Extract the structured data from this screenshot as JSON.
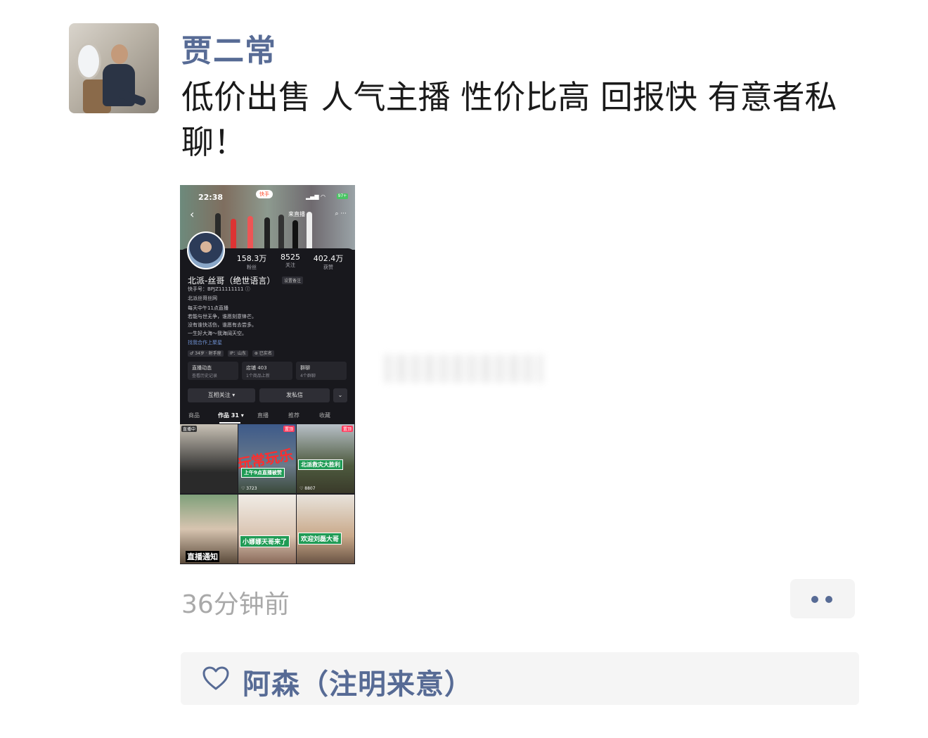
{
  "post": {
    "username": "贾二常",
    "text": "低价出售 人气主播 性价比高 回报快 有意者私聊！",
    "time_ago": "36分钟前"
  },
  "likes": {
    "names": "阿森（注明来意）"
  },
  "screenshot": {
    "status_time": "22:38",
    "battery": "97+",
    "app_badge": "快手",
    "search_text": "来直播",
    "profile_name": "北派-丝哥（绝世语言）",
    "profile_tag": "设置备注",
    "stats": [
      {
        "num": "158.3万",
        "label": "粉丝"
      },
      {
        "num": "8525",
        "label": "关注"
      },
      {
        "num": "402.4万",
        "label": "获赞"
      }
    ],
    "kuaishou_id": "快手号：BPJZ11111111 ⓘ",
    "line_ip": "北派丝哥丝网",
    "bio": [
      "每天中午11点直播",
      "若能与世无争，谁愿刻意锋芒。",
      "没有谁快活伤，谁愿有去尝多。",
      "一生好大海～我海阔天空。"
    ],
    "bio_link": "找我合作上聚星",
    "chips": [
      "♂ 34岁 · 射手座",
      "IP：山东",
      "⊛ 已实名"
    ],
    "cards": [
      {
        "title": "直播动态",
        "sub": "查看历史记录"
      },
      {
        "title": "店铺 403",
        "sub": "1个商品上新"
      },
      {
        "title": "群聊",
        "sub": "4个群聊"
      }
    ],
    "buttons": {
      "follow": "互相关注 ▾",
      "message": "发私信",
      "more": "⌄"
    },
    "tabs": [
      "商品",
      "作品 31 ▾",
      "直播",
      "推荐",
      "收藏"
    ],
    "tiles": [
      {
        "corner": "直播中"
      },
      {
        "corner": "置顶",
        "big": "玩常玩乐",
        "label": "上午9点直播被赞",
        "views": "♡ 3723"
      },
      {
        "corner": "置顶",
        "label": "北派救灾大胜利",
        "views": "♡ 8807"
      },
      {
        "yellow": "直播通知"
      },
      {
        "label": "小娜娜天哥来了"
      },
      {
        "label": "欢迎刘磊大哥"
      }
    ]
  },
  "colors": {
    "link_blue": "#576b95",
    "text_dark": "#1a1a1a",
    "time_gray": "#a9a9a9",
    "like_bg": "#f5f5f5"
  },
  "icons": {
    "heart": "heart-outline-icon",
    "more": "two-dot-more-icon"
  }
}
